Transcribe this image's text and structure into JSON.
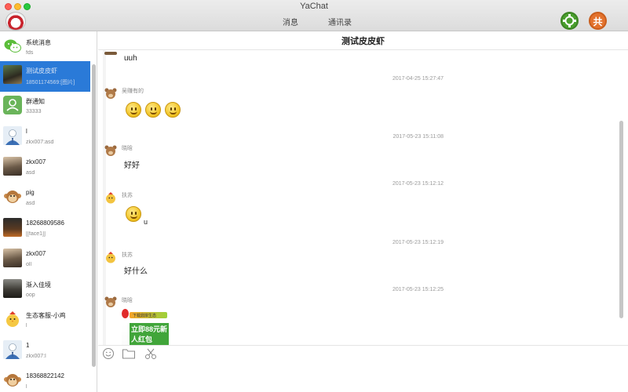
{
  "window": {
    "title": "YaChat"
  },
  "nav": {
    "tab_messages": "消息",
    "tab_contacts": "通讯录"
  },
  "toolbar": {
    "green_icon": "puzzle-icon",
    "orange_label": "共"
  },
  "contacts": [
    {
      "name": "系统消息",
      "preview": "fds",
      "avatar": "wechat-icon"
    },
    {
      "name": "测试皮皮虾",
      "preview": "18501174569:[图片]",
      "avatar": "photo",
      "selected": true
    },
    {
      "name": "群通知",
      "preview": "33333",
      "avatar": "group-icon"
    },
    {
      "name": "l",
      "preview": "zkx007:asd",
      "avatar": "default-user"
    },
    {
      "name": "zkx007",
      "preview": "asd",
      "avatar": "photo"
    },
    {
      "name": "pig",
      "preview": "asd",
      "avatar": "monkey"
    },
    {
      "name": "18268809586",
      "preview": "[[face1]]",
      "avatar": "photo"
    },
    {
      "name": "zkx007",
      "preview": "oll",
      "avatar": "photo"
    },
    {
      "name": "渐入佳境",
      "preview": "oop",
      "avatar": "photo"
    },
    {
      "name": "生态客服-小鸡",
      "preview": "l",
      "avatar": "chick"
    },
    {
      "name": "1",
      "preview": "zkx007:l",
      "avatar": "default-user"
    },
    {
      "name": "18368822142",
      "preview": "l",
      "avatar": "monkey"
    }
  ],
  "chat": {
    "title": "测试皮皮虾",
    "messages": [
      {
        "text": "uuh"
      },
      {
        "timestamp": "2017-04-25 15:27:47",
        "sender": "吴赚有的",
        "emojis": 3
      },
      {
        "timestamp": "2017-05-23 15:11:08",
        "sender": "晓晗",
        "text": "好好"
      },
      {
        "timestamp": "2017-05-23 15:12:12",
        "sender": "扶苏",
        "text": "u",
        "emojis": 1
      },
      {
        "timestamp": "2017-05-23 15:12:19",
        "sender": "扶苏",
        "text": "好什么"
      },
      {
        "timestamp": "2017-05-23 15:12:25",
        "sender": "晓晗",
        "sticker_line1": "下载鼎岸生态",
        "sticker_line2": "立即88元新人红包"
      }
    ]
  },
  "input_tools": [
    "smile-icon",
    "folder-icon",
    "scissors-icon"
  ]
}
